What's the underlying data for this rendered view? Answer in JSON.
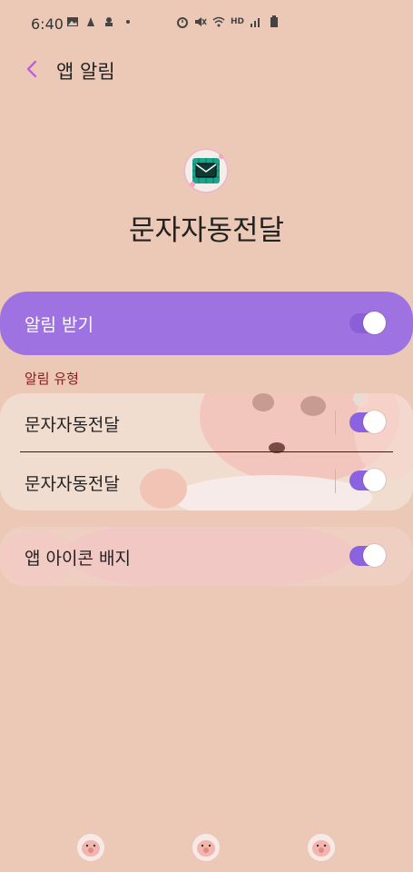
{
  "status": {
    "time": "6:40",
    "left_icons": [
      "gallery-icon",
      "app-notification-icon",
      "app-notification-icon",
      "dot-icon"
    ],
    "right_icons": [
      "alarm-icon",
      "mute-icon",
      "wifi-icon",
      "hd-voice-icon",
      "signal-icon",
      "battery-icon"
    ],
    "hd_text": "HD"
  },
  "header": {
    "title": "앱 알림"
  },
  "app": {
    "name": "문자자동전달",
    "icon": "mail-icon"
  },
  "master_toggle": {
    "label": "알림 받기",
    "on": true
  },
  "section": {
    "title": "알림 유형"
  },
  "channels": [
    {
      "label": "문자자동전달",
      "on": true
    },
    {
      "label": "문자자동전달",
      "on": true
    }
  ],
  "badge": {
    "label": "앱 아이콘 배지",
    "on": true
  },
  "colors": {
    "background": "#ecc9b6",
    "accent": "#9e72e0",
    "toggle_on": "#8b62df",
    "section_header": "#8b1a1a",
    "back_arrow": "#c060d8"
  },
  "navbar": {
    "buttons": [
      "recent-apps-button",
      "home-button",
      "back-button"
    ]
  }
}
